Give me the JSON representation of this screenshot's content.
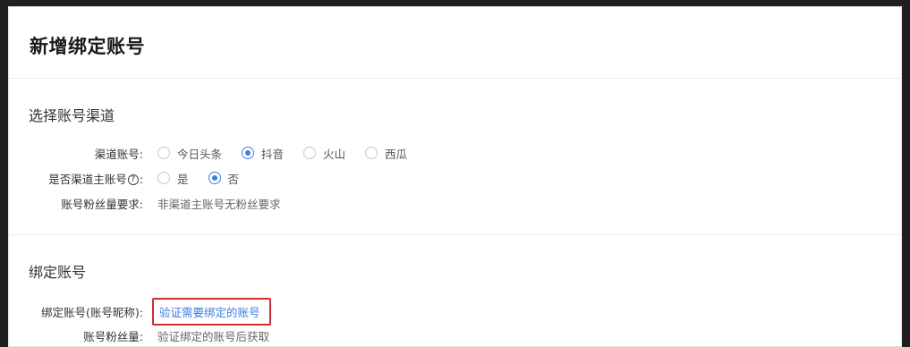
{
  "page": {
    "title": "新增绑定账号"
  },
  "channel_section": {
    "title": "选择账号渠道",
    "channel_label": "渠道账号:",
    "channel_options": [
      "今日头条",
      "抖音",
      "火山",
      "西瓜"
    ],
    "channel_selected": "抖音",
    "is_main_label_pre": "是否渠道主账号",
    "is_main_label_help": "?",
    "is_main_label_post": ":",
    "is_main_options": [
      "是",
      "否"
    ],
    "is_main_selected": "否",
    "fans_req_label": "账号粉丝量要求:",
    "fans_req_value": "非渠道主账号无粉丝要求"
  },
  "bind_section": {
    "title": "绑定账号",
    "nickname_label": "绑定账号(账号昵称):",
    "verify_link": "验证需要绑定的账号",
    "fans_label": "账号粉丝量:",
    "fans_value": "验证绑定的账号后获取"
  },
  "colors": {
    "accent": "#3c7ee0",
    "highlight_border": "#c9302c"
  }
}
